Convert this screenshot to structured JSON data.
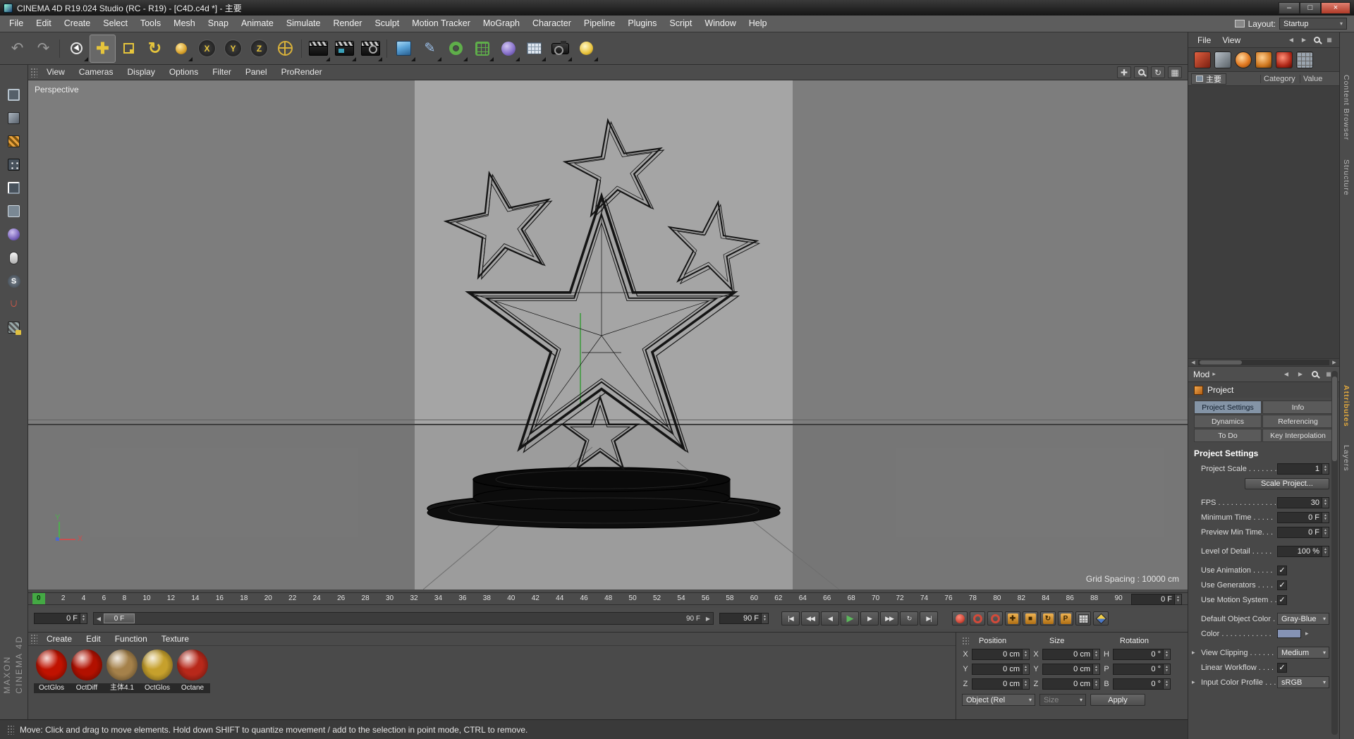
{
  "colors": {
    "accent": "#e2a93e",
    "play_green": "#5cb85c",
    "record_red": "#d24a3a",
    "tab_active": "#8494a6",
    "gray_blue": "#8593b5",
    "frame_green": "#44a944",
    "octane_orange": "#e07820"
  },
  "titlebar": {
    "title": "CINEMA 4D R19.024 Studio (RC - R19) - [C4D.c4d *] - 主要",
    "minimize": "–",
    "maximize": "□",
    "close": "×"
  },
  "menubar": {
    "items": [
      "File",
      "Edit",
      "Create",
      "Select",
      "Tools",
      "Mesh",
      "Snap",
      "Animate",
      "Simulate",
      "Render",
      "Sculpt",
      "Motion Tracker",
      "MoGraph",
      "Character",
      "Pipeline",
      "Plugins",
      "Script",
      "Window",
      "Help"
    ],
    "layout_label": "Layout:",
    "layout_value": "Startup"
  },
  "icons": {
    "undo": "↶",
    "redo": "↷",
    "lock_x": "X",
    "lock_y": "Y",
    "lock_z": "Z",
    "rotate": "↻",
    "move": "✚",
    "pen": "✎",
    "back": "◀",
    "forward": "▶",
    "up": "▲",
    "dn": "▼",
    "down": "▾",
    "exp": "▸",
    "check": "✓",
    "goto_start": "|◀",
    "prev_key": "◀◀",
    "prev_frame": "◀",
    "play": "▶",
    "next_frame": "▶",
    "next_key": "▶▶",
    "goto_end": "▶|",
    "loop": "↻",
    "pan": "✚",
    "views": "▦",
    "snap_s": "S",
    "magnet": "∩",
    "param": "P",
    "scale_box": "■"
  },
  "viewport": {
    "menu": [
      "View",
      "Cameras",
      "Display",
      "Options",
      "Filter",
      "Panel",
      "ProRender"
    ],
    "label": "Perspective",
    "grid": "Grid Spacing : 10000 cm",
    "axis_x": "X",
    "axis_y": "Y"
  },
  "timeline": {
    "ticks": [
      "0",
      "2",
      "4",
      "6",
      "8",
      "10",
      "12",
      "14",
      "16",
      "18",
      "20",
      "22",
      "24",
      "26",
      "28",
      "30",
      "32",
      "34",
      "36",
      "38",
      "40",
      "42",
      "44",
      "46",
      "48",
      "50",
      "52",
      "54",
      "56",
      "58",
      "60",
      "62",
      "64",
      "66",
      "68",
      "70",
      "72",
      "74",
      "76",
      "78",
      "80",
      "82",
      "84",
      "86",
      "88",
      "90"
    ],
    "end_value": "0 F"
  },
  "anim": {
    "current": "0 F",
    "slider_current": "0 F",
    "slider_end": "90 F",
    "range_end": "90 F"
  },
  "materials": {
    "menu": [
      "Create",
      "Edit",
      "Function",
      "Texture"
    ],
    "items": [
      {
        "name": "OctGlos",
        "color": "#c01200"
      },
      {
        "name": "OctDiff",
        "color": "#b21000"
      },
      {
        "name": "主体4.1",
        "color": "#a5814a"
      },
      {
        "name": "OctGlos",
        "color": "#c6a02c"
      },
      {
        "name": "Octane",
        "color": "#b8281a"
      }
    ]
  },
  "coords": {
    "headers": [
      "Position",
      "Size",
      "Rotation"
    ],
    "rows": [
      {
        "pl": "X",
        "pv": "0 cm",
        "sl": "X",
        "sv": "0 cm",
        "rl": "H",
        "rv": "0 °"
      },
      {
        "pl": "Y",
        "pv": "0 cm",
        "sl": "Y",
        "sv": "0 cm",
        "rl": "P",
        "rv": "0 °"
      },
      {
        "pl": "Z",
        "pv": "0 cm",
        "sl": "Z",
        "sv": "0 cm",
        "rl": "B",
        "rv": "0 °"
      }
    ],
    "object_mode": "Object (Rel",
    "size_mode": "Size",
    "apply": "Apply"
  },
  "right_top": {
    "menus": [
      "File",
      "View"
    ],
    "tab": "主要",
    "columns": [
      "Category",
      "Value"
    ]
  },
  "attrs": {
    "mode": "Mod",
    "object_name": "Project",
    "tabs": [
      "Project Settings",
      "Info",
      "Dynamics",
      "Referencing",
      "To Do",
      "Key Interpolation"
    ],
    "section": "Project Settings",
    "project_scale": {
      "label": "Project Scale . . . . . . .",
      "value": "1"
    },
    "scale_project": "Scale Project...",
    "fps": {
      "label": "FPS . . . . . . . . . . . . . . .",
      "value": "30"
    },
    "minimum_time": {
      "label": "Minimum Time . . . . .",
      "value": "0 F"
    },
    "preview_min_time": {
      "label": "Preview Min Time. . .",
      "value": "0 F"
    },
    "level_of_detail": {
      "label": "Level of Detail . . . . .",
      "value": "100 %"
    },
    "use_animation": {
      "label": "Use Animation . . . . ."
    },
    "use_generators": {
      "label": "Use Generators . . . ."
    },
    "use_motion_system": {
      "label": "Use Motion System . ."
    },
    "default_object_color": {
      "label": "Default Object Color .",
      "value": "Gray-Blue"
    },
    "color": {
      "label": "Color . . . . . . . . . . . ."
    },
    "view_clipping": {
      "label": "View Clipping . . . . . .",
      "value": "Medium"
    },
    "linear_workflow": {
      "label": "Linear Workflow . . . ."
    },
    "input_color_profile": {
      "label": "Input Color Profile . . .",
      "value": "sRGB"
    }
  },
  "dock_tabs": [
    "Content Browser",
    "Structure",
    "Attributes",
    "Layers"
  ],
  "status": {
    "text": "Move: Click and drag to move elements. Hold down SHIFT to quantize movement / add to the selection in point mode, CTRL to remove."
  },
  "brand": {
    "line1": "MAXON",
    "line2": "CINEMA 4D"
  }
}
